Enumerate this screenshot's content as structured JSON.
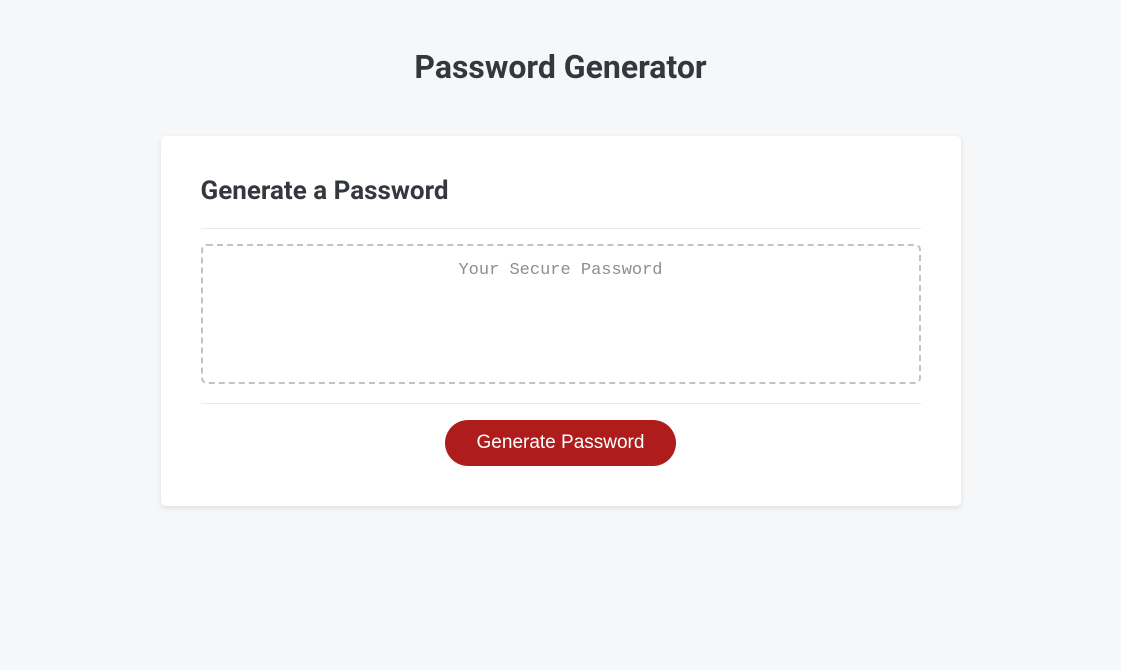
{
  "header": {
    "title": "Password Generator"
  },
  "card": {
    "title": "Generate a Password",
    "password_placeholder": "Your Secure Password",
    "password_value": "",
    "button_label": "Generate Password"
  },
  "colors": {
    "background": "#f6f7f8",
    "card_background": "#ffffff",
    "text_primary": "#34383e",
    "text_muted": "#8a8f95",
    "border": "#e7e9eb",
    "dashed_border": "#c0c4c8",
    "button_bg": "#af1c1c",
    "button_text": "#ffffff"
  }
}
